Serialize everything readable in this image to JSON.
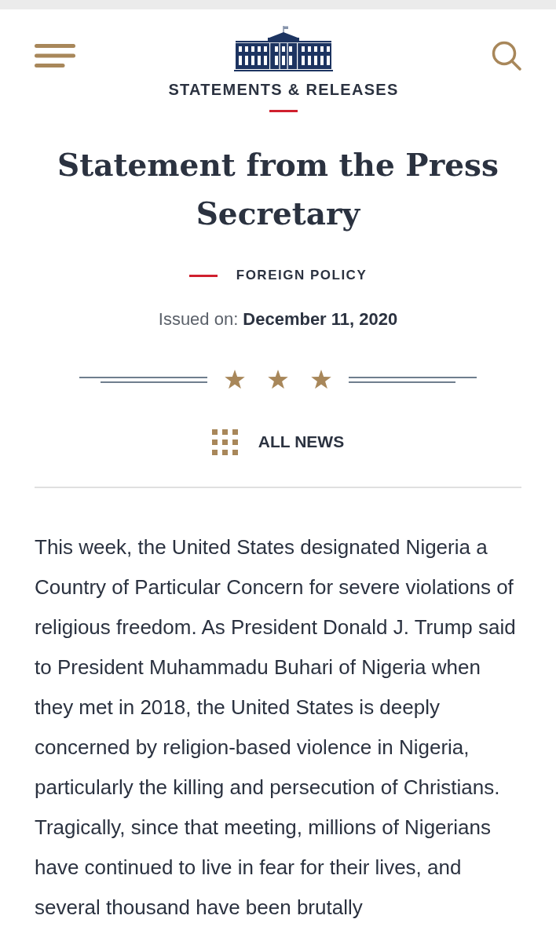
{
  "header": {
    "section_title": "STATEMENTS & RELEASES"
  },
  "article": {
    "title": "Statement from the Press Secretary",
    "category": "FOREIGN POLICY",
    "issued": {
      "label": "Issued on:",
      "date": "December 11, 2020"
    },
    "all_news": "ALL NEWS",
    "body": "This week, the United States designated Nigeria a Country of Particular Concern for severe violations of religious freedom. As President Donald J. Trump said to President Muhammadu Buhari of Nigeria when they met in 2018, the United States is deeply concerned by religion-based violence in Nigeria, particularly the killing and persecution of Christians. Tragically, since that meeting, millions of Nigerians have continued to live in fear for their lives, and several thousand have been brutally"
  }
}
